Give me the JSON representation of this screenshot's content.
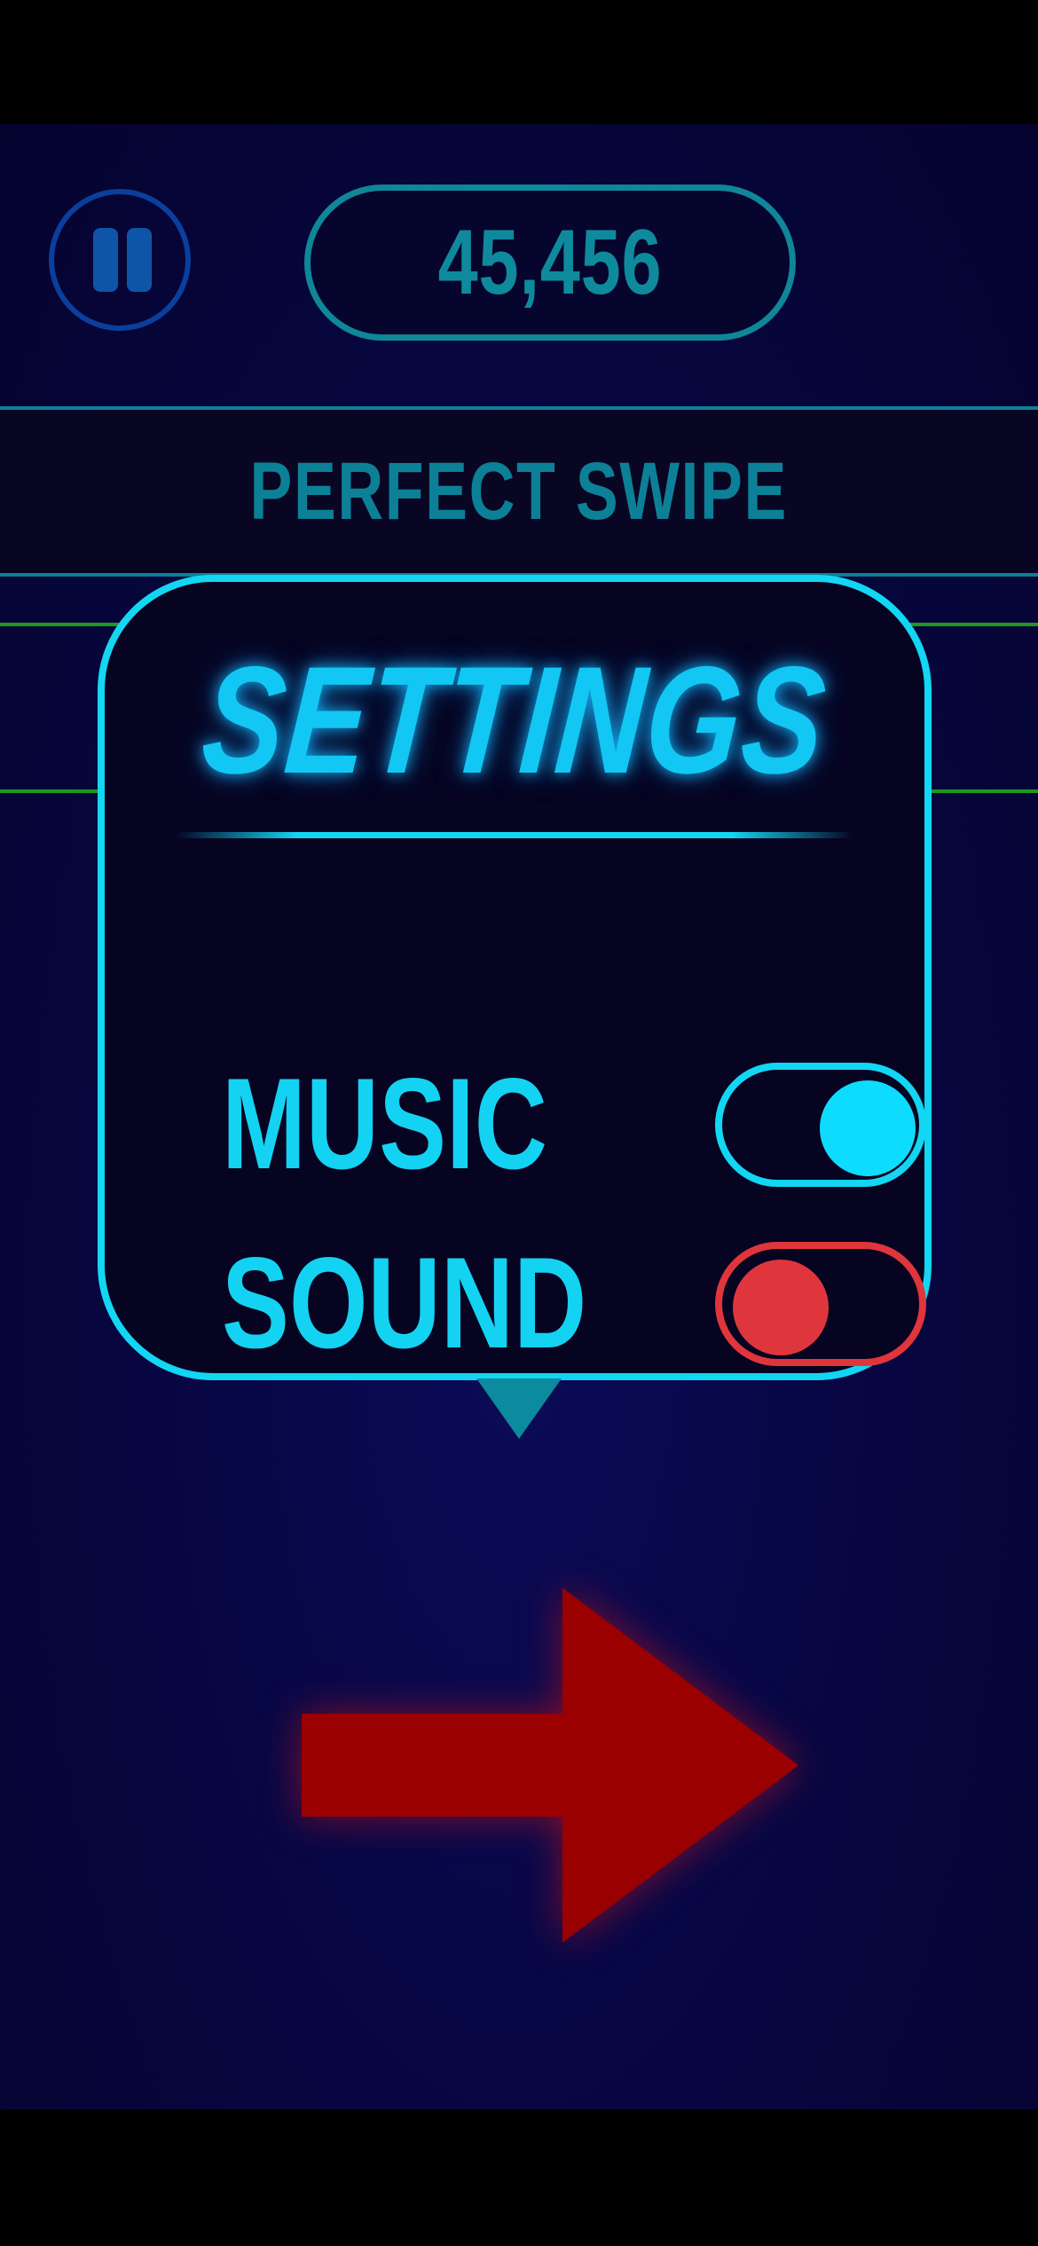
{
  "hud": {
    "score": "45,456",
    "pause_icon": "pause-icon"
  },
  "banner": {
    "text": "PERFECT SWIPE"
  },
  "settings": {
    "title": "SETTINGS",
    "rows": [
      {
        "label": "MUSIC",
        "state": "on"
      },
      {
        "label": "SOUND",
        "state": "off"
      }
    ]
  },
  "arrow": {
    "direction": "right",
    "icon": "right-arrow-icon"
  },
  "colors": {
    "accent_cyan": "#13d6f2",
    "toggle_off_red": "#e0353b",
    "arrow_red": "#9a0000",
    "lane_green": "#1c9a1c",
    "background": "#07063f"
  }
}
